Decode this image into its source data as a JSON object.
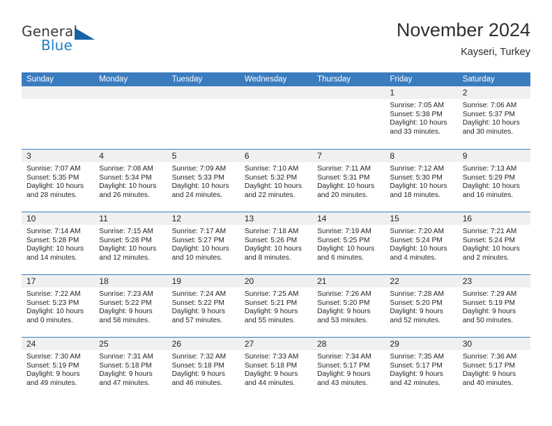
{
  "brand": {
    "word1": "General",
    "word2": "Blue",
    "triangle_color": "#1464a5",
    "blue_color": "#1f7fc4"
  },
  "header": {
    "title": "November 2024",
    "subtitle": "Kayseri, Turkey"
  },
  "theme": {
    "header_blue": "#3b7cbf",
    "daynum_bg": "#f0f0f0",
    "text": "#231f20"
  },
  "calendar": {
    "weekday_headers": [
      "Sunday",
      "Monday",
      "Tuesday",
      "Wednesday",
      "Thursday",
      "Friday",
      "Saturday"
    ],
    "labels": {
      "sunrise": "Sunrise:",
      "sunset": "Sunset:",
      "daylight": "Daylight:"
    },
    "weeks": [
      [
        {
          "day": "",
          "empty": true
        },
        {
          "day": "",
          "empty": true
        },
        {
          "day": "",
          "empty": true
        },
        {
          "day": "",
          "empty": true
        },
        {
          "day": "",
          "empty": true
        },
        {
          "day": "1",
          "sunrise": "Sunrise: 7:05 AM",
          "sunset": "Sunset: 5:38 PM",
          "daylight1": "Daylight: 10 hours",
          "daylight2": "and 33 minutes."
        },
        {
          "day": "2",
          "sunrise": "Sunrise: 7:06 AM",
          "sunset": "Sunset: 5:37 PM",
          "daylight1": "Daylight: 10 hours",
          "daylight2": "and 30 minutes."
        }
      ],
      [
        {
          "day": "3",
          "sunrise": "Sunrise: 7:07 AM",
          "sunset": "Sunset: 5:35 PM",
          "daylight1": "Daylight: 10 hours",
          "daylight2": "and 28 minutes."
        },
        {
          "day": "4",
          "sunrise": "Sunrise: 7:08 AM",
          "sunset": "Sunset: 5:34 PM",
          "daylight1": "Daylight: 10 hours",
          "daylight2": "and 26 minutes."
        },
        {
          "day": "5",
          "sunrise": "Sunrise: 7:09 AM",
          "sunset": "Sunset: 5:33 PM",
          "daylight1": "Daylight: 10 hours",
          "daylight2": "and 24 minutes."
        },
        {
          "day": "6",
          "sunrise": "Sunrise: 7:10 AM",
          "sunset": "Sunset: 5:32 PM",
          "daylight1": "Daylight: 10 hours",
          "daylight2": "and 22 minutes."
        },
        {
          "day": "7",
          "sunrise": "Sunrise: 7:11 AM",
          "sunset": "Sunset: 5:31 PM",
          "daylight1": "Daylight: 10 hours",
          "daylight2": "and 20 minutes."
        },
        {
          "day": "8",
          "sunrise": "Sunrise: 7:12 AM",
          "sunset": "Sunset: 5:30 PM",
          "daylight1": "Daylight: 10 hours",
          "daylight2": "and 18 minutes."
        },
        {
          "day": "9",
          "sunrise": "Sunrise: 7:13 AM",
          "sunset": "Sunset: 5:29 PM",
          "daylight1": "Daylight: 10 hours",
          "daylight2": "and 16 minutes."
        }
      ],
      [
        {
          "day": "10",
          "sunrise": "Sunrise: 7:14 AM",
          "sunset": "Sunset: 5:28 PM",
          "daylight1": "Daylight: 10 hours",
          "daylight2": "and 14 minutes."
        },
        {
          "day": "11",
          "sunrise": "Sunrise: 7:15 AM",
          "sunset": "Sunset: 5:28 PM",
          "daylight1": "Daylight: 10 hours",
          "daylight2": "and 12 minutes."
        },
        {
          "day": "12",
          "sunrise": "Sunrise: 7:17 AM",
          "sunset": "Sunset: 5:27 PM",
          "daylight1": "Daylight: 10 hours",
          "daylight2": "and 10 minutes."
        },
        {
          "day": "13",
          "sunrise": "Sunrise: 7:18 AM",
          "sunset": "Sunset: 5:26 PM",
          "daylight1": "Daylight: 10 hours",
          "daylight2": "and 8 minutes."
        },
        {
          "day": "14",
          "sunrise": "Sunrise: 7:19 AM",
          "sunset": "Sunset: 5:25 PM",
          "daylight1": "Daylight: 10 hours",
          "daylight2": "and 6 minutes."
        },
        {
          "day": "15",
          "sunrise": "Sunrise: 7:20 AM",
          "sunset": "Sunset: 5:24 PM",
          "daylight1": "Daylight: 10 hours",
          "daylight2": "and 4 minutes."
        },
        {
          "day": "16",
          "sunrise": "Sunrise: 7:21 AM",
          "sunset": "Sunset: 5:24 PM",
          "daylight1": "Daylight: 10 hours",
          "daylight2": "and 2 minutes."
        }
      ],
      [
        {
          "day": "17",
          "sunrise": "Sunrise: 7:22 AM",
          "sunset": "Sunset: 5:23 PM",
          "daylight1": "Daylight: 10 hours",
          "daylight2": "and 0 minutes."
        },
        {
          "day": "18",
          "sunrise": "Sunrise: 7:23 AM",
          "sunset": "Sunset: 5:22 PM",
          "daylight1": "Daylight: 9 hours",
          "daylight2": "and 58 minutes."
        },
        {
          "day": "19",
          "sunrise": "Sunrise: 7:24 AM",
          "sunset": "Sunset: 5:22 PM",
          "daylight1": "Daylight: 9 hours",
          "daylight2": "and 57 minutes."
        },
        {
          "day": "20",
          "sunrise": "Sunrise: 7:25 AM",
          "sunset": "Sunset: 5:21 PM",
          "daylight1": "Daylight: 9 hours",
          "daylight2": "and 55 minutes."
        },
        {
          "day": "21",
          "sunrise": "Sunrise: 7:26 AM",
          "sunset": "Sunset: 5:20 PM",
          "daylight1": "Daylight: 9 hours",
          "daylight2": "and 53 minutes."
        },
        {
          "day": "22",
          "sunrise": "Sunrise: 7:28 AM",
          "sunset": "Sunset: 5:20 PM",
          "daylight1": "Daylight: 9 hours",
          "daylight2": "and 52 minutes."
        },
        {
          "day": "23",
          "sunrise": "Sunrise: 7:29 AM",
          "sunset": "Sunset: 5:19 PM",
          "daylight1": "Daylight: 9 hours",
          "daylight2": "and 50 minutes."
        }
      ],
      [
        {
          "day": "24",
          "sunrise": "Sunrise: 7:30 AM",
          "sunset": "Sunset: 5:19 PM",
          "daylight1": "Daylight: 9 hours",
          "daylight2": "and 49 minutes."
        },
        {
          "day": "25",
          "sunrise": "Sunrise: 7:31 AM",
          "sunset": "Sunset: 5:18 PM",
          "daylight1": "Daylight: 9 hours",
          "daylight2": "and 47 minutes."
        },
        {
          "day": "26",
          "sunrise": "Sunrise: 7:32 AM",
          "sunset": "Sunset: 5:18 PM",
          "daylight1": "Daylight: 9 hours",
          "daylight2": "and 46 minutes."
        },
        {
          "day": "27",
          "sunrise": "Sunrise: 7:33 AM",
          "sunset": "Sunset: 5:18 PM",
          "daylight1": "Daylight: 9 hours",
          "daylight2": "and 44 minutes."
        },
        {
          "day": "28",
          "sunrise": "Sunrise: 7:34 AM",
          "sunset": "Sunset: 5:17 PM",
          "daylight1": "Daylight: 9 hours",
          "daylight2": "and 43 minutes."
        },
        {
          "day": "29",
          "sunrise": "Sunrise: 7:35 AM",
          "sunset": "Sunset: 5:17 PM",
          "daylight1": "Daylight: 9 hours",
          "daylight2": "and 42 minutes."
        },
        {
          "day": "30",
          "sunrise": "Sunrise: 7:36 AM",
          "sunset": "Sunset: 5:17 PM",
          "daylight1": "Daylight: 9 hours",
          "daylight2": "and 40 minutes."
        }
      ]
    ]
  }
}
